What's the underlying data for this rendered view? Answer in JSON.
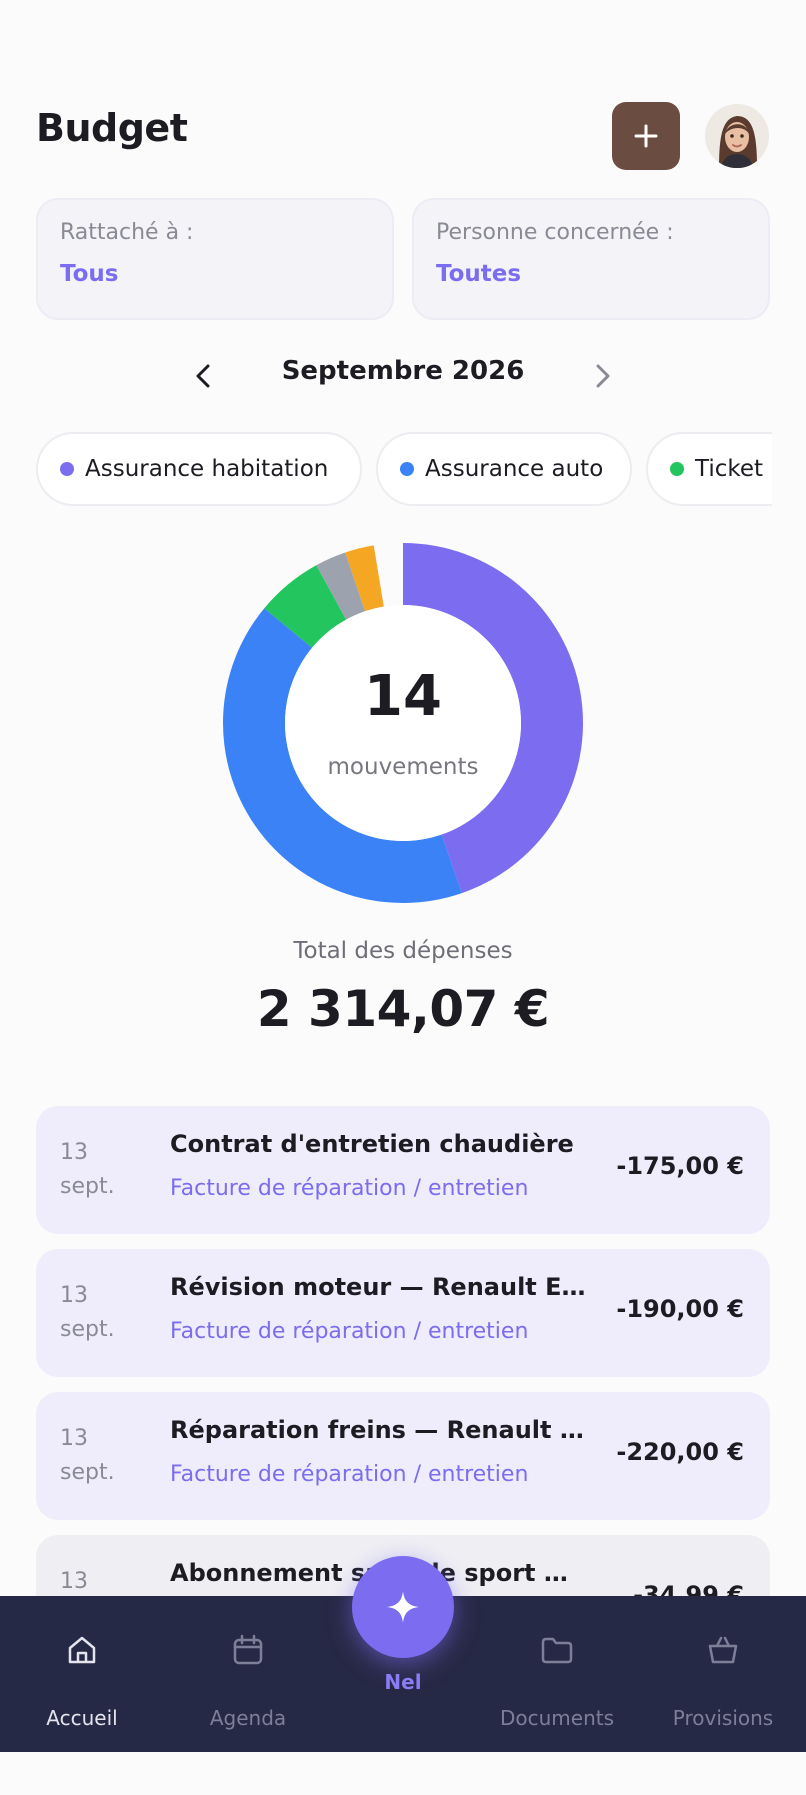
{
  "header": {
    "title": "Budget",
    "add_icon": "plus-icon",
    "avatar_icon": "user-avatar"
  },
  "filters": [
    {
      "label": "Rattaché à :",
      "value": "Tous"
    },
    {
      "label": "Personne concernée :",
      "value": "Toutes"
    }
  ],
  "month": {
    "title": "Septembre 2026",
    "prev_icon": "chevron-left-icon",
    "next_icon": "chevron-right-icon"
  },
  "categories": [
    {
      "label": "Assurance habitation",
      "color": "#7b6cf0"
    },
    {
      "label": "Assurance auto",
      "color": "#3b82f6"
    },
    {
      "label": "Ticket",
      "color": "#22c55e"
    }
  ],
  "chart_data": {
    "type": "pie",
    "title": "",
    "slices": [
      {
        "color": "#7b6cf0",
        "fraction": 0.447
      },
      {
        "color": "#3b82f6",
        "fraction": 0.413
      },
      {
        "color": "#22c55e",
        "fraction": 0.06
      },
      {
        "color": "#9ca3af",
        "fraction": 0.028
      },
      {
        "color": "#f5a623",
        "fraction": 0.026
      }
    ]
  },
  "summary": {
    "count": "14",
    "count_caption": "mouvements",
    "total_label": "Total des dépenses",
    "total_value": "2 314,07 €"
  },
  "transactions": [
    {
      "day": "13",
      "month": "sept.",
      "title": "Contrat d'entretien chaudière",
      "subtitle": "Facture de réparation / entretien",
      "amount": "-175,00 €"
    },
    {
      "day": "13",
      "month": "sept.",
      "title": "Révision moteur — Renault Esp…",
      "subtitle": "Facture de réparation / entretien",
      "amount": "-190,00 €"
    },
    {
      "day": "13",
      "month": "sept.",
      "title": "Réparation freins — Renault Es…",
      "subtitle": "Facture de réparation / entretien",
      "amount": "-220,00 €"
    },
    {
      "day": "13",
      "month": "",
      "title": "Abonnement salle de sport — A…",
      "subtitle": "",
      "amount": "-34,99 €"
    }
  ],
  "nav": {
    "items": [
      {
        "label": "Accueil",
        "icon": "home-icon"
      },
      {
        "label": "Agenda",
        "icon": "calendar-icon"
      },
      {
        "label": "Documents",
        "icon": "folder-icon"
      },
      {
        "label": "Provisions",
        "icon": "basket-icon"
      }
    ],
    "fab_label": "Nel",
    "fab_icon": "sparkle-icon"
  }
}
